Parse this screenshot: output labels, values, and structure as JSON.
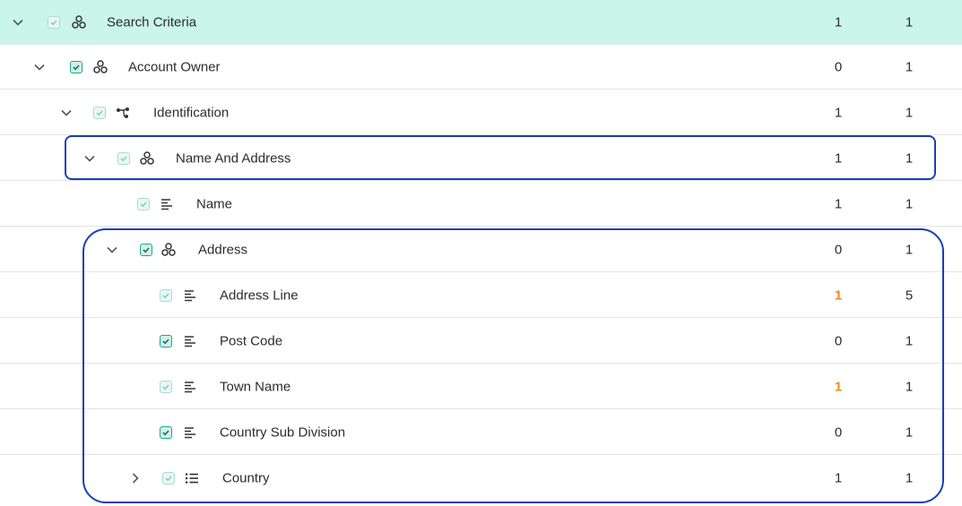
{
  "tree": {
    "rows": [
      {
        "label": "Search Criteria",
        "min": "1",
        "max": "1"
      },
      {
        "label": "Account Owner",
        "min": "0",
        "max": "1"
      },
      {
        "label": "Identification",
        "min": "1",
        "max": "1"
      },
      {
        "label": "Name And Address",
        "min": "1",
        "max": "1"
      },
      {
        "label": "Name",
        "min": "1",
        "max": "1"
      },
      {
        "label": "Address",
        "min": "0",
        "max": "1"
      },
      {
        "label": "Address Line",
        "min": "1",
        "max": "5"
      },
      {
        "label": "Post Code",
        "min": "0",
        "max": "1"
      },
      {
        "label": "Town Name",
        "min": "1",
        "max": "1"
      },
      {
        "label": "Country Sub Division",
        "min": "0",
        "max": "1"
      },
      {
        "label": "Country",
        "min": "1",
        "max": "1"
      }
    ]
  },
  "colors": {
    "selected_row": "#c9f5ea",
    "highlight_outline": "#1a3fb8",
    "warning_number": "#f08a1c",
    "checkbox_accent": "#1aa68a"
  },
  "icons": {
    "group": "group-icon",
    "choice": "choice-branch-icon",
    "field": "text-field-icon",
    "list": "list-icon"
  }
}
